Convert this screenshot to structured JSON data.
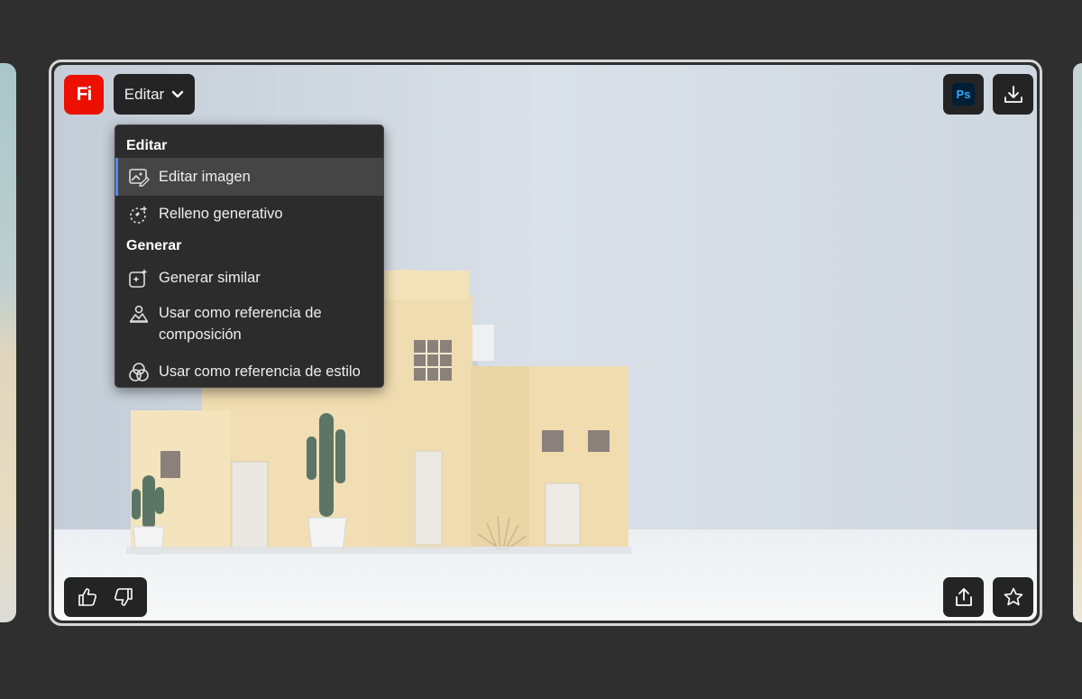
{
  "app": {
    "logo_text": "Fi",
    "logo_color": "#eb1000"
  },
  "toolbar": {
    "edit_label": "Editar"
  },
  "menu": {
    "section_edit": "Editar",
    "edit_image": "Editar imagen",
    "generative_fill": "Relleno generativo",
    "section_generate": "Generar",
    "generate_similar": "Generar similar",
    "composition_reference": "Usar como referencia de composición",
    "style_reference": "Usar como referencia de estilo"
  },
  "icons": {
    "photoshop": "Ps",
    "download": "download-icon",
    "share": "share-icon",
    "favorite": "star-icon",
    "like": "thumbs-up-icon",
    "dislike": "thumbs-down-icon"
  },
  "colors": {
    "accent": "#4a8ef0",
    "ps_blue": "#31a8ff",
    "ps_bg": "#001e36"
  }
}
